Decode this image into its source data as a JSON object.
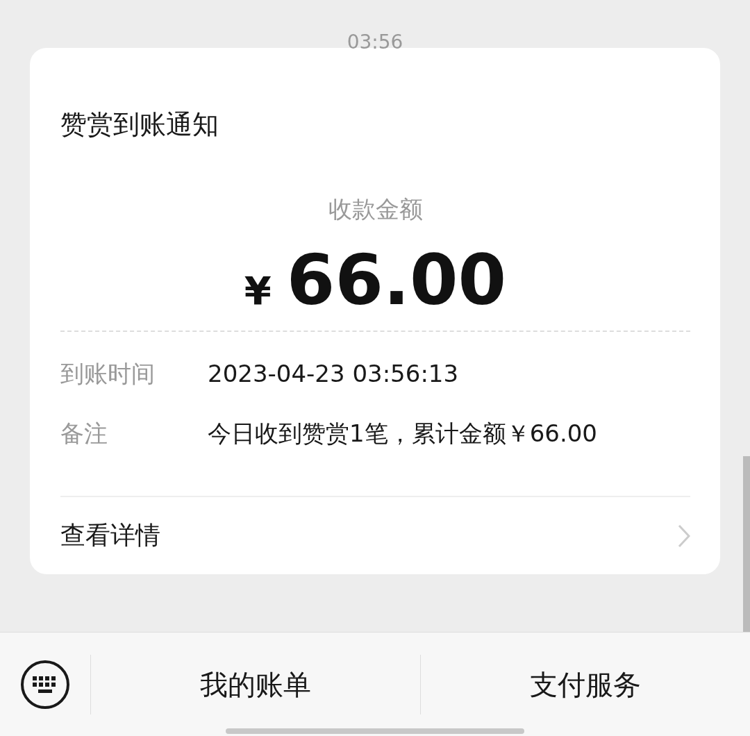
{
  "time": "03:56",
  "card": {
    "title": "赞赏到账通知",
    "amount_label": "收款金额",
    "currency": "¥",
    "amount": "66.00",
    "rows": [
      {
        "label": "到账时间",
        "value": "2023-04-23 03:56:13"
      },
      {
        "label": "备注",
        "value": "今日收到赞赏1笔，累计金额￥66.00"
      }
    ],
    "link": "查看详情"
  },
  "menu": [
    "我的账单",
    "支付服务"
  ]
}
